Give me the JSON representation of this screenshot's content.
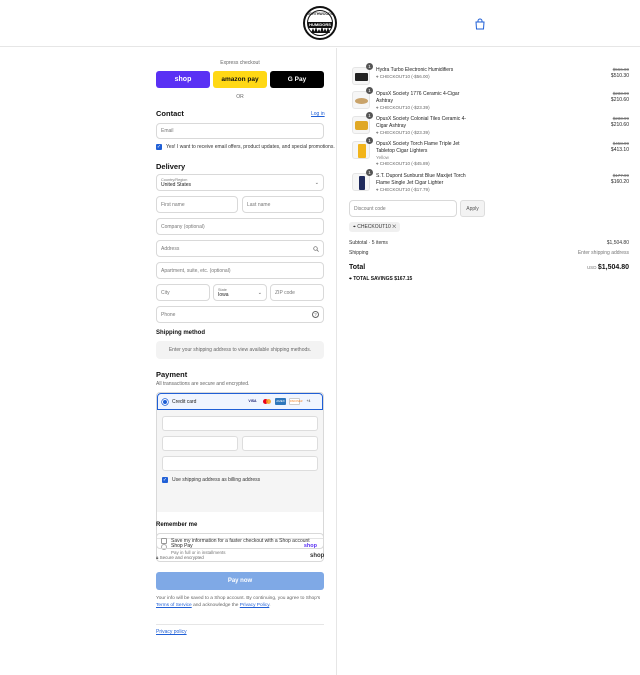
{
  "brand": {
    "logo_top": "NORTHWOODS",
    "logo_band": "HUMIDORS"
  },
  "express": {
    "label": "Express checkout",
    "shop_label": "shop",
    "amazon_label": "amazon pay",
    "gpay_label": "G Pay",
    "or_label": "OR"
  },
  "contact": {
    "title": "Contact",
    "login_link": "Log in",
    "email_placeholder": "Email",
    "news_label": "Yes! I want to receive email offers, product updates, and special promotions."
  },
  "delivery": {
    "title": "Delivery",
    "country_label": "Country/Region",
    "country_value": "United States",
    "first_name": "First name",
    "last_name": "Last name",
    "company": "Company (optional)",
    "address": "Address",
    "apartment": "Apartment, suite, etc. (optional)",
    "city": "City",
    "state_label": "State",
    "state_value": "Iowa",
    "zip": "ZIP code",
    "phone": "Phone"
  },
  "shipping": {
    "title": "Shipping method",
    "notice": "Enter your shipping address to view available shipping methods."
  },
  "payment": {
    "title": "Payment",
    "subtitle": "All transactions are secure and encrypted.",
    "credit_card": "Credit card",
    "card_brands": [
      "VISA",
      "MC",
      "AMEX",
      "DISCOVER",
      "+4"
    ],
    "billing_same": "Use shipping address as billing address",
    "shop_pay": "Shop Pay",
    "shop_pay_sub": "Pay in full or in installments",
    "shop_pay_logo": "shop"
  },
  "remember": {
    "title": "Remember me",
    "save_label": "Save my information for a faster checkout with a Shop account",
    "secure": "Secure and encrypted",
    "shop_logo": "shop"
  },
  "pay_button": "Pay now",
  "legal": {
    "text1": "Your info will be saved to a Shop account. By continuing, you agree to Shop's",
    "terms": "Terms of Service",
    "mid": "and acknowledge the",
    "privacy": "Privacy Policy",
    "end": ".",
    "privacy_policy_link": "Privacy policy"
  },
  "cart": {
    "items": [
      {
        "qty": "1",
        "name": "Hydra Turbo Electronic Humidifiers",
        "variant": "",
        "discount": "CHECKOUT10 (-$56.00)",
        "old_price": "$566.00",
        "price": "$510.30"
      },
      {
        "qty": "1",
        "name": "OpusX Society 1776 Ceramic 4-Cigar Ashtray",
        "variant": "",
        "discount": "CHECKOUT10 (-$23.39)",
        "old_price": "$233.99",
        "price": "$210.60"
      },
      {
        "qty": "1",
        "name": "OpusX Society Colonial Tiles Ceramic 4-Cigar Ashtray",
        "variant": "",
        "discount": "CHECKOUT10 (-$23.39)",
        "old_price": "$233.99",
        "price": "$210.60"
      },
      {
        "qty": "1",
        "name": "OpusX Society Torch Flame Triple Jet Tabletop Cigar Lighters",
        "variant": "Yellow",
        "discount": "CHECKOUT10 (-$45.89)",
        "old_price": "$458.99",
        "price": "$413.10"
      },
      {
        "qty": "1",
        "name": "S.T. Dupont Sunburst Blue Maxijet Torch Flame Single Jet Cigar Lighter",
        "variant": "",
        "discount": "CHECKOUT10 (-$17.79)",
        "old_price": "$177.99",
        "price": "$160.20"
      }
    ],
    "discount_placeholder": "Discount code",
    "apply_label": "Apply",
    "applied_code": "CHECKOUT10",
    "subtotal_label": "Subtotal · 5 items",
    "subtotal_value": "$1,504.80",
    "shipping_label": "Shipping",
    "shipping_value": "Enter shipping address",
    "total_label": "Total",
    "currency": "USD",
    "total_value": "$1,504.80",
    "savings_label": "TOTAL SAVINGS",
    "savings_value": "$167.15"
  }
}
